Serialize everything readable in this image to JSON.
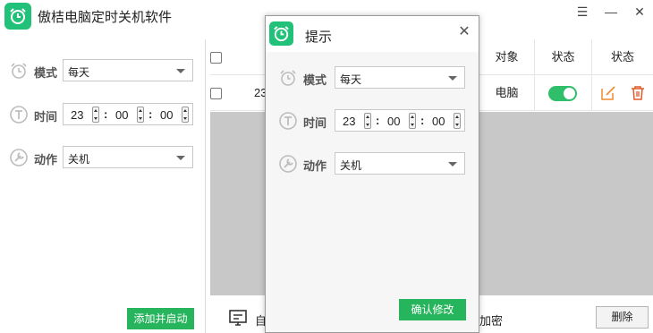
{
  "app": {
    "title": "傲桔电脑定时关机软件",
    "controls": {
      "menu": "☰",
      "minimize": "—",
      "close": "✕"
    }
  },
  "form": {
    "mode_label": "模式",
    "mode_value": "每天",
    "time_label": "时间",
    "hour": "23",
    "minute": "00",
    "second": "00",
    "colon": ":",
    "action_label": "动作",
    "action_value": "关机",
    "add_button": "添加并启动"
  },
  "table": {
    "headers": [
      "对象",
      "状态",
      "状态"
    ],
    "row": {
      "time_partial": "23",
      "target": "电脑",
      "enabled": true
    }
  },
  "bottom": {
    "option1_partial": "自",
    "option2_partial": "加密",
    "delete_button": "删除"
  },
  "dialog": {
    "title": "提示",
    "close": "✕",
    "confirm_button": "确认修改"
  },
  "colors": {
    "brand_green": "#22c17a",
    "button_green": "#26b45c",
    "edit_orange": "#f08a2c",
    "delete_red": "#e25a2a",
    "table_empty_gray": "#c8c8c8"
  }
}
